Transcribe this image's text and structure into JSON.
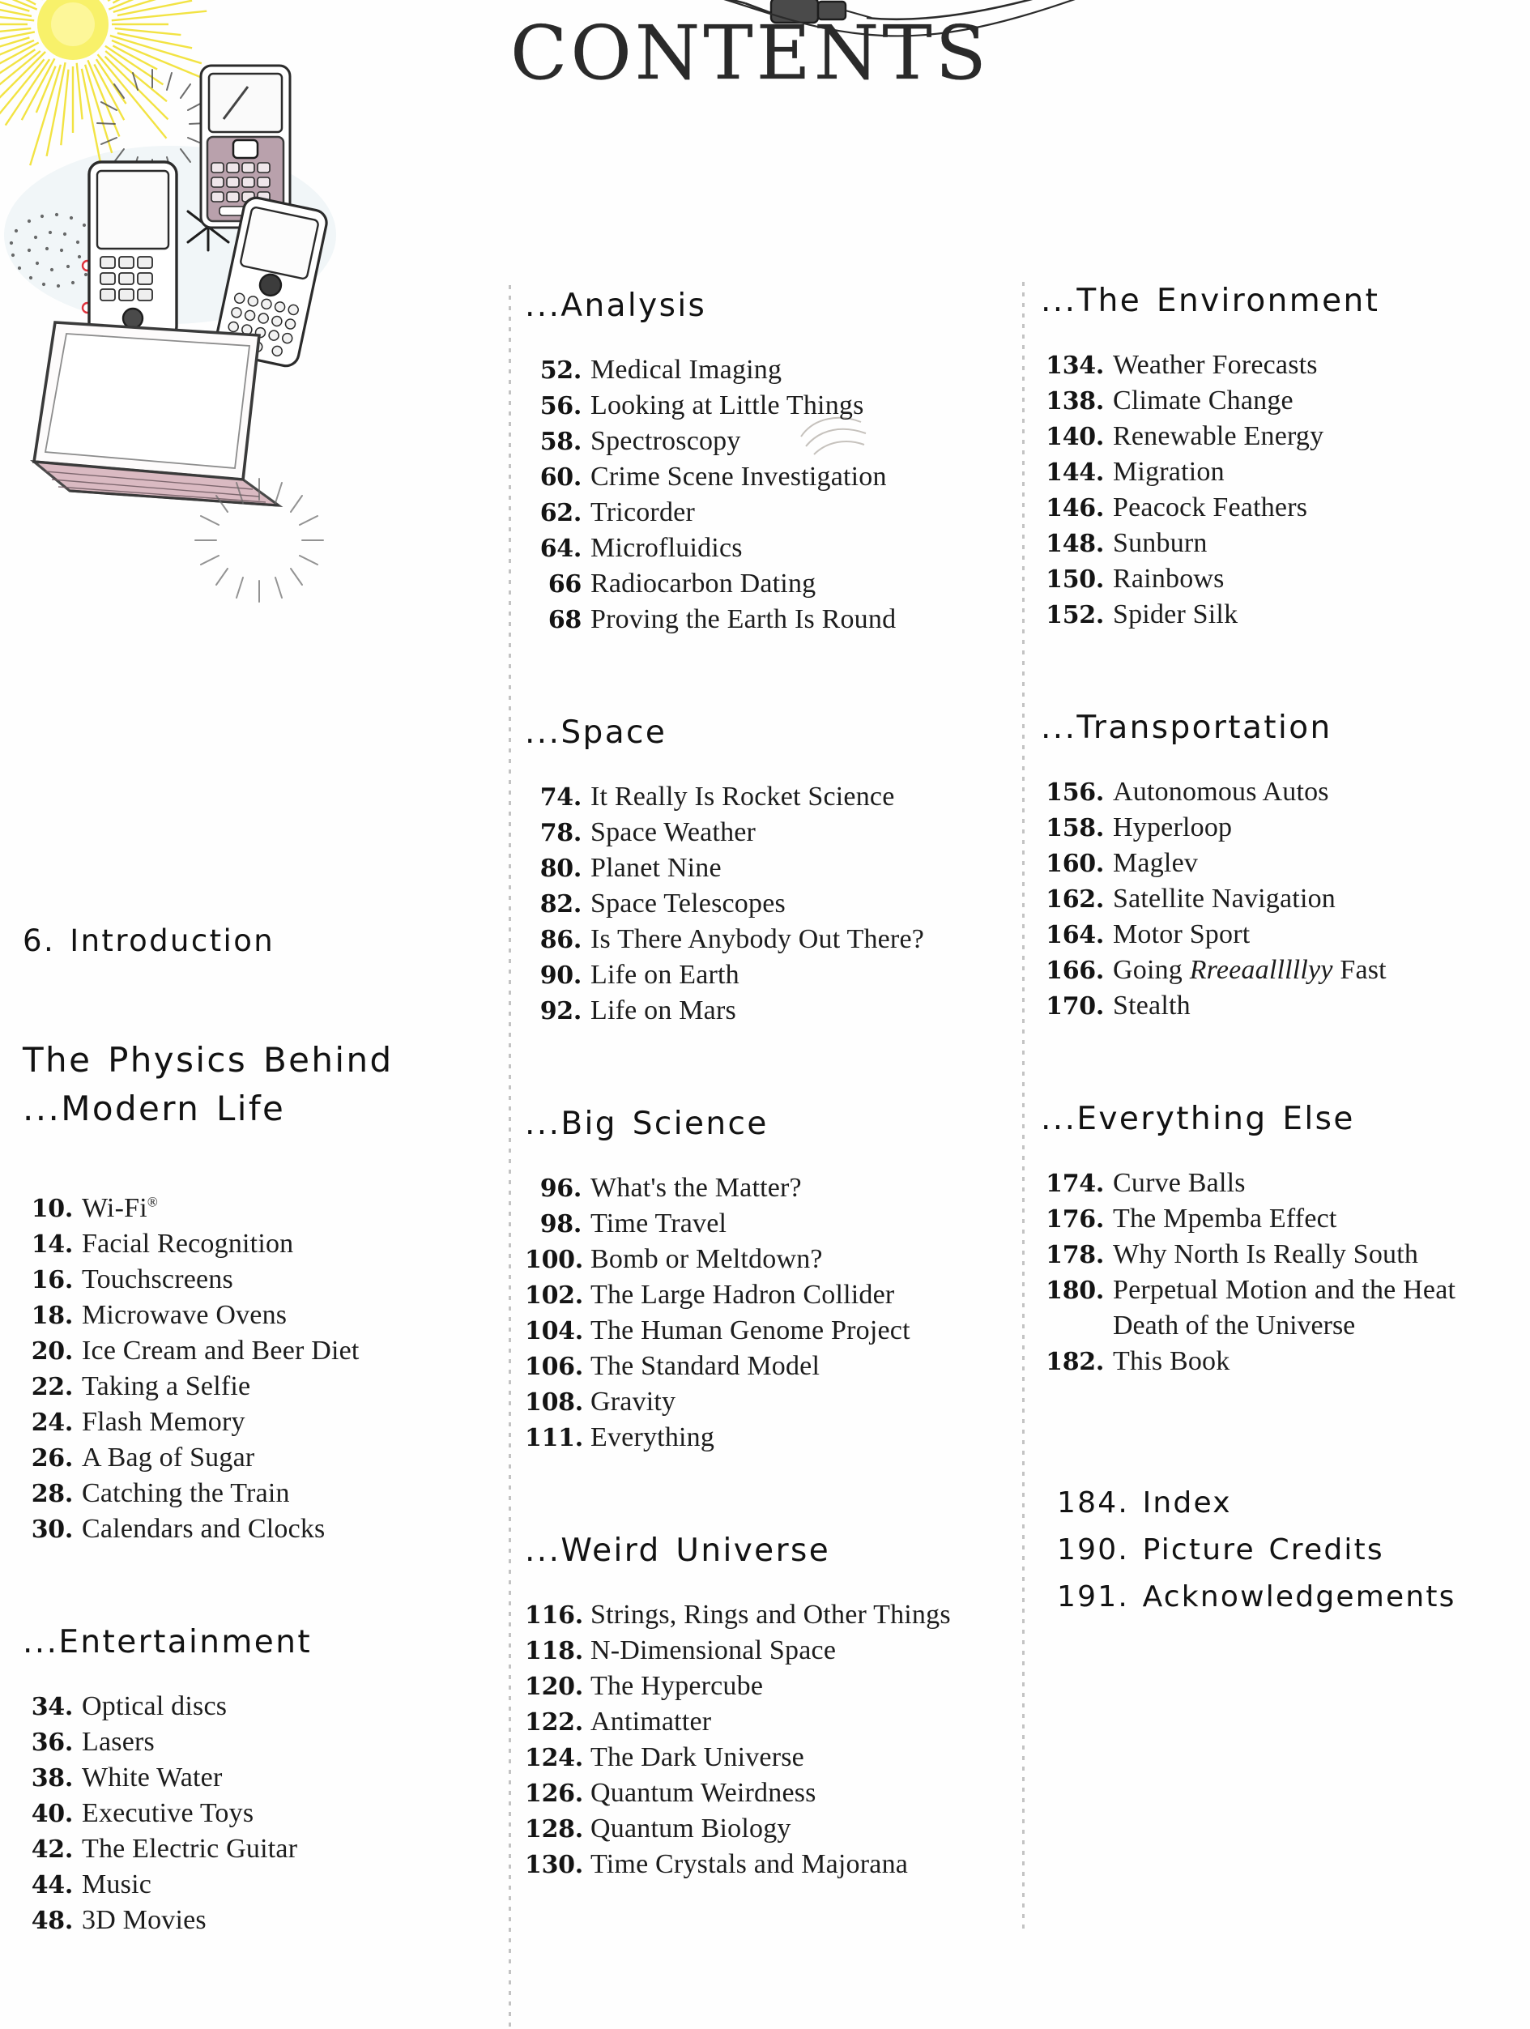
{
  "page": {
    "title": "CONTENTS"
  },
  "left_column": {
    "intro": "6. Introduction",
    "main_heading_line1": "The Physics Behind",
    "main_heading_line2": "...Modern Life",
    "modern_life_entries": [
      {
        "num": "10.",
        "label": "Wi-Fi",
        "sup": "®"
      },
      {
        "num": "14.",
        "label": "Facial Recognition"
      },
      {
        "num": "16.",
        "label": "Touchscreens"
      },
      {
        "num": "18.",
        "label": "Microwave Ovens"
      },
      {
        "num": "20.",
        "label": "Ice Cream and Beer Diet"
      },
      {
        "num": "22.",
        "label": "Taking a Selfie"
      },
      {
        "num": "24.",
        "label": "Flash Memory"
      },
      {
        "num": "26.",
        "label": "A Bag of Sugar"
      },
      {
        "num": "28.",
        "label": "Catching the Train"
      },
      {
        "num": "30.",
        "label": "Calendars and Clocks"
      }
    ],
    "entertainment_heading": "...Entertainment",
    "entertainment_entries": [
      {
        "num": "34.",
        "label": "Optical discs"
      },
      {
        "num": "36.",
        "label": "Lasers"
      },
      {
        "num": "38.",
        "label": "White Water"
      },
      {
        "num": "40.",
        "label": "Executive Toys"
      },
      {
        "num": "42.",
        "label": "The Electric Guitar"
      },
      {
        "num": "44.",
        "label": "Music"
      },
      {
        "num": "48.",
        "label": "3D Movies"
      }
    ]
  },
  "middle_column": {
    "analysis_heading": "...Analysis",
    "analysis_entries": [
      {
        "num": "52.",
        "label": "Medical Imaging"
      },
      {
        "num": "56.",
        "label": "Looking at Little Things"
      },
      {
        "num": "58.",
        "label": "Spectroscopy"
      },
      {
        "num": "60.",
        "label": "Crime Scene Investigation"
      },
      {
        "num": "62.",
        "label": "Tricorder"
      },
      {
        "num": "64.",
        "label": "Microfluidics"
      },
      {
        "num": "66",
        "label": "Radiocarbon Dating"
      },
      {
        "num": "68",
        "label": "Proving the Earth Is Round"
      }
    ],
    "space_heading": "...Space",
    "space_entries": [
      {
        "num": "74.",
        "label": "It Really Is Rocket Science"
      },
      {
        "num": "78.",
        "label": "Space Weather"
      },
      {
        "num": "80.",
        "label": "Planet Nine"
      },
      {
        "num": "82.",
        "label": "Space Telescopes"
      },
      {
        "num": "86.",
        "label": "Is There Anybody Out There?"
      },
      {
        "num": "90.",
        "label": "Life on Earth"
      },
      {
        "num": "92.",
        "label": "Life on Mars"
      }
    ],
    "big_science_heading": "...Big Science",
    "big_science_entries": [
      {
        "num": "96.",
        "label": "What's the Matter?"
      },
      {
        "num": "98.",
        "label": "Time Travel"
      },
      {
        "num": "100.",
        "label": "Bomb or Meltdown?"
      },
      {
        "num": "102.",
        "label": "The Large Hadron Collider"
      },
      {
        "num": "104.",
        "label": "The Human Genome Project"
      },
      {
        "num": "106.",
        "label": "The Standard Model"
      },
      {
        "num": "108.",
        "label": "Gravity"
      },
      {
        "num": "111.",
        "label": "Everything"
      }
    ],
    "weird_universe_heading": "...Weird Universe",
    "weird_universe_entries": [
      {
        "num": "116.",
        "label": "Strings, Rings and Other Things"
      },
      {
        "num": "118.",
        "label": "N-Dimensional Space"
      },
      {
        "num": "120.",
        "label": "The Hypercube"
      },
      {
        "num": "122.",
        "label": "Antimatter"
      },
      {
        "num": "124.",
        "label": "The Dark Universe"
      },
      {
        "num": "126.",
        "label": "Quantum Weirdness"
      },
      {
        "num": "128.",
        "label": "Quantum Biology"
      },
      {
        "num": "130.",
        "label": "Time Crystals and Majorana"
      }
    ]
  },
  "right_column": {
    "environment_heading": "...The Environment",
    "environment_entries": [
      {
        "num": "134.",
        "label": "Weather Forecasts"
      },
      {
        "num": "138.",
        "label": "Climate Change"
      },
      {
        "num": "140.",
        "label": "Renewable Energy"
      },
      {
        "num": "144.",
        "label": "Migration"
      },
      {
        "num": "146.",
        "label": "Peacock Feathers"
      },
      {
        "num": "148.",
        "label": "Sunburn"
      },
      {
        "num": "150.",
        "label": "Rainbows"
      },
      {
        "num": "152.",
        "label": "Spider Silk"
      }
    ],
    "transportation_heading": "...Transportation",
    "transportation_entries": [
      {
        "num": "156.",
        "label": "Autonomous Autos"
      },
      {
        "num": "158.",
        "label": "Hyperloop"
      },
      {
        "num": "160.",
        "label": "Maglev"
      },
      {
        "num": "162.",
        "label": "Satellite Navigation"
      },
      {
        "num": "164.",
        "label": "Motor Sport"
      },
      {
        "num": "166.",
        "label_pre": "Going ",
        "label_italic": "Rreeaalllllyy",
        "label_post": " Fast"
      },
      {
        "num": "170.",
        "label": "Stealth"
      }
    ],
    "everything_else_heading": "...Everything Else",
    "everything_else_entries": [
      {
        "num": "174.",
        "label": "Curve Balls"
      },
      {
        "num": "176.",
        "label": "The Mpemba Effect"
      },
      {
        "num": "178.",
        "label": "Why North Is Really South"
      },
      {
        "num": "180.",
        "label": "Perpetual Motion and the Heat",
        "continuation": "Death of the Universe"
      },
      {
        "num": "182.",
        "label": "This Book"
      }
    ],
    "back_matter": [
      "184. Index",
      "190. Picture Credits",
      "191. Acknowledgements"
    ]
  },
  "illustrations": {
    "sunburst": "sun-rays-illustration",
    "phone_keypad": "feature-phone-illustration",
    "smartphone": "smartphone-illustration",
    "blackberry": "qwerty-phone-illustration",
    "laptop": "laptop-illustration",
    "halo": "dotted-halo-illustration",
    "star": "star-burst-illustration",
    "red_graph": "red-network-graph-illustration",
    "cable": "audio-cable-illustration",
    "dot_cluster": "dot-cluster-illustration"
  },
  "colors": {
    "ink": "#1a1a1a",
    "sun_yellow": "#f2e23a",
    "phone_mauve": "#b49aa6",
    "laptop_pink": "#d8b5bd",
    "red_accent": "#e0323c",
    "rule_grey": "#b9b9b9",
    "wash_blue": "#dfe9ef"
  }
}
